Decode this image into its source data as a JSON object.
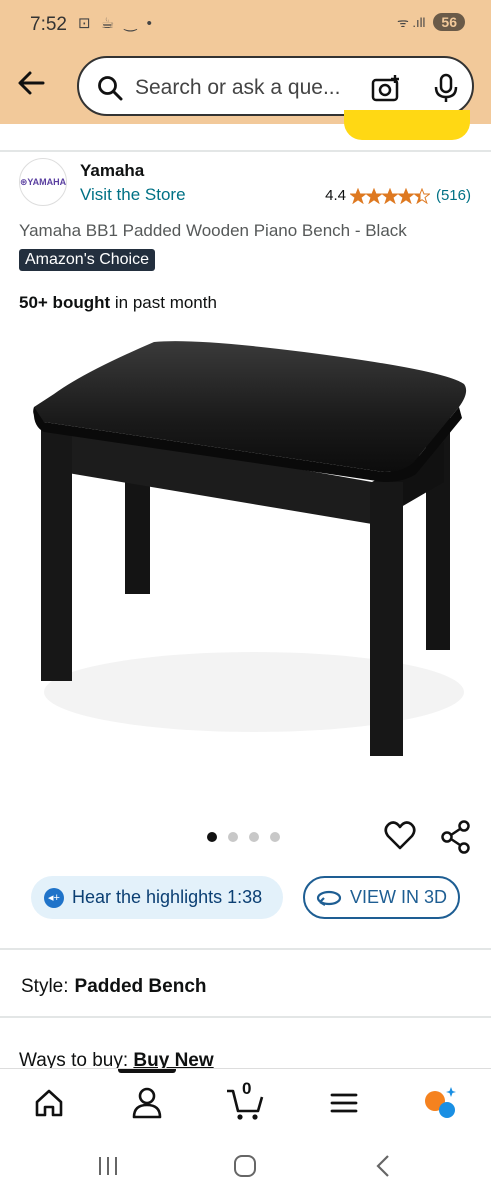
{
  "status_bar": {
    "time": "7:52",
    "icons": "⊡ ☕ ‿ •",
    "signal": "ᯤ .ıll",
    "battery": "56"
  },
  "search": {
    "placeholder": "Search or ask a que..."
  },
  "brand": {
    "logo_text": "⊛YAMAHA",
    "name": "Yamaha",
    "visit": "Visit the Store"
  },
  "rating": {
    "value": "4.4",
    "stars": 4.4,
    "count": "(516)"
  },
  "product": {
    "title": "Yamaha BB1 Padded Wooden Piano Bench - Black",
    "badge": "Amazon's Choice",
    "bought_bold": "50+ bought",
    "bought_rest": " in past month",
    "image_index": 1,
    "image_total": 4
  },
  "actions": {
    "hear_label": "Hear the highlights 1:38",
    "view3d_label": "VIEW IN 3D"
  },
  "style": {
    "label": "Style:",
    "value": "Padded Bench"
  },
  "ways": {
    "label": "Ways to buy:",
    "value": "Buy New"
  },
  "bottom_nav": {
    "cart_count": "0"
  },
  "colors": {
    "header": "#f2c99a",
    "link": "#007185",
    "star": "#de7921",
    "badge": "#232f3e",
    "cart_button": "#ffd814"
  }
}
